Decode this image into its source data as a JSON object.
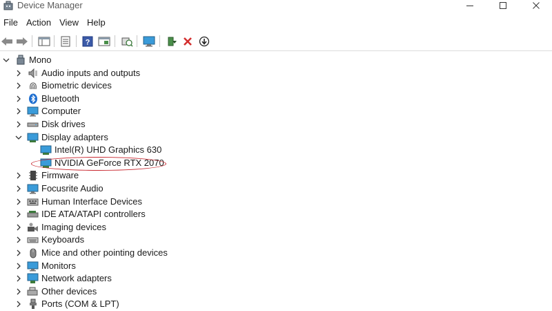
{
  "window": {
    "title": "Device Manager"
  },
  "menu": {
    "items": [
      "File",
      "Action",
      "View",
      "Help"
    ]
  },
  "toolbar": {
    "buttons": [
      "back-arrow-icon",
      "forward-arrow-icon",
      "properties-panel-icon",
      "list-view-icon",
      "help-icon",
      "properties-sheet-icon",
      "scan-hardware-icon",
      "monitor-icon",
      "update-driver-icon",
      "uninstall-x-icon",
      "disable-device-icon"
    ]
  },
  "tree": {
    "root": "Mono",
    "categories": [
      {
        "label": "Audio inputs and outputs",
        "icon": "speaker-icon",
        "expanded": false
      },
      {
        "label": "Biometric devices",
        "icon": "fingerprint-icon",
        "expanded": false
      },
      {
        "label": "Bluetooth",
        "icon": "bluetooth-icon",
        "expanded": false
      },
      {
        "label": "Computer",
        "icon": "computer-icon",
        "expanded": false
      },
      {
        "label": "Disk drives",
        "icon": "disk-drive-icon",
        "expanded": false
      },
      {
        "label": "Display adapters",
        "icon": "display-adapter-icon",
        "expanded": true,
        "children": [
          "Intel(R) UHD Graphics 630",
          "NVIDIA GeForce RTX 2070"
        ]
      },
      {
        "label": "Firmware",
        "icon": "firmware-chip-icon",
        "expanded": false
      },
      {
        "label": "Focusrite Audio",
        "icon": "monitor-icon",
        "expanded": false
      },
      {
        "label": "Human Interface Devices",
        "icon": "hid-icon",
        "expanded": false
      },
      {
        "label": "IDE ATA/ATAPI controllers",
        "icon": "ide-controller-icon",
        "expanded": false
      },
      {
        "label": "Imaging devices",
        "icon": "camera-icon",
        "expanded": false
      },
      {
        "label": "Keyboards",
        "icon": "keyboard-icon",
        "expanded": false
      },
      {
        "label": "Mice and other pointing devices",
        "icon": "mouse-icon",
        "expanded": false
      },
      {
        "label": "Monitors",
        "icon": "monitor-icon",
        "expanded": false
      },
      {
        "label": "Network adapters",
        "icon": "network-adapter-icon",
        "expanded": false
      },
      {
        "label": "Other devices",
        "icon": "unknown-device-icon",
        "expanded": false
      },
      {
        "label": "Ports (COM & LPT)",
        "icon": "port-icon",
        "expanded": false
      }
    ]
  },
  "colors": {
    "highlight_ellipse": "#c8262e",
    "monitor_blue": "#3a9bd9",
    "error_red": "#d32f2f"
  }
}
